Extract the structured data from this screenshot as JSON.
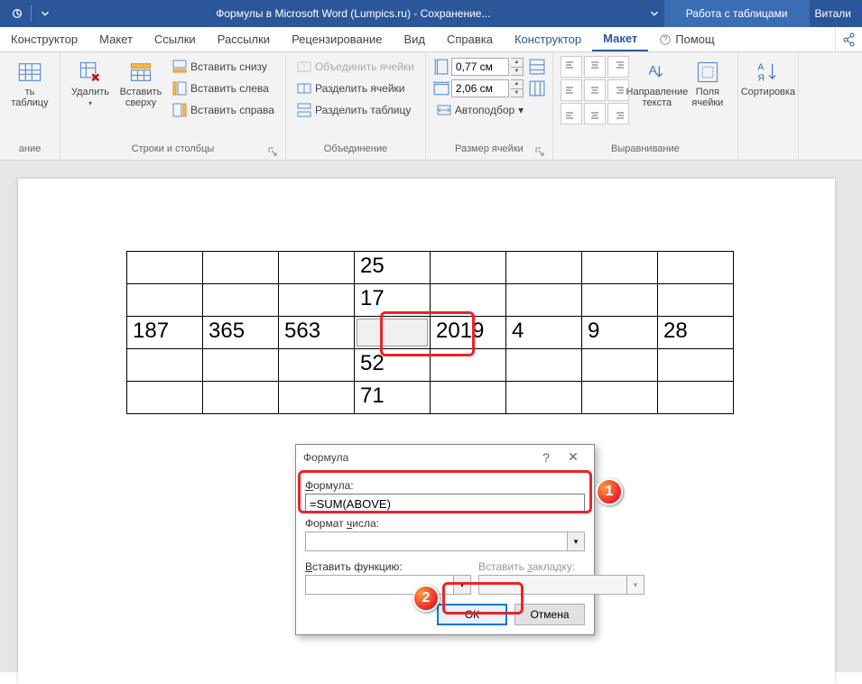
{
  "titlebar": {
    "doc_title": "Формулы в Microsoft Word (Lumpics.ru)  -  Сохранение...",
    "context_tab": "Работа с таблицами",
    "user": "Витали"
  },
  "tabs": {
    "konstruktor": "Конструктор",
    "maket": "Макет",
    "ssylki": "Ссылки",
    "rassylki": "Рассылки",
    "recenz": "Рецензирование",
    "vid": "Вид",
    "spravka": "Справка",
    "konstruktor2": "Конструктор",
    "maket2": "Макет",
    "help": "Помощ"
  },
  "ribbon": {
    "draw_table": "ть таблицу",
    "draw_group": "ание",
    "delete": "Удалить",
    "insert_above": "Вставить сверху",
    "insert_below": "Вставить снизу",
    "insert_left": "Вставить слева",
    "insert_right": "Вставить справа",
    "rows_cols_group": "Строки и столбцы",
    "merge_cells": "Объединить ячейки",
    "split_cells": "Разделить ячейки",
    "split_table": "Разделить таблицу",
    "merge_group": "Объединение",
    "height_val": "0,77 см",
    "width_val": "2,06 см",
    "autofit": "Автоподбор",
    "size_group": "Размер ячейки",
    "text_dir": "Направление текста",
    "cell_margins": "Поля ячейки",
    "align_group": "Выравнивание",
    "sort": "Сортировка"
  },
  "table": {
    "r1": [
      "",
      "",
      "",
      "25",
      "",
      "",
      "",
      ""
    ],
    "r2": [
      "",
      "",
      "",
      "17",
      "",
      "",
      "",
      ""
    ],
    "r3": [
      "187",
      "365",
      "563",
      "",
      "2019",
      "4",
      "9",
      "28"
    ],
    "r4": [
      "",
      "",
      "",
      "52",
      "",
      "",
      "",
      ""
    ],
    "r5": [
      "",
      "",
      "",
      "71",
      "",
      "",
      "",
      ""
    ]
  },
  "dialog": {
    "title": "Формула",
    "formula_label": "Формула:",
    "formula_value": "=SUM(ABOVE)",
    "format_label": "Формат числа:",
    "insert_func_label": "Вставить функцию:",
    "insert_bookmark_label": "Вставить закладку:",
    "ok": "ОК",
    "cancel": "Отмена"
  },
  "badges": {
    "one": "1",
    "two": "2"
  }
}
